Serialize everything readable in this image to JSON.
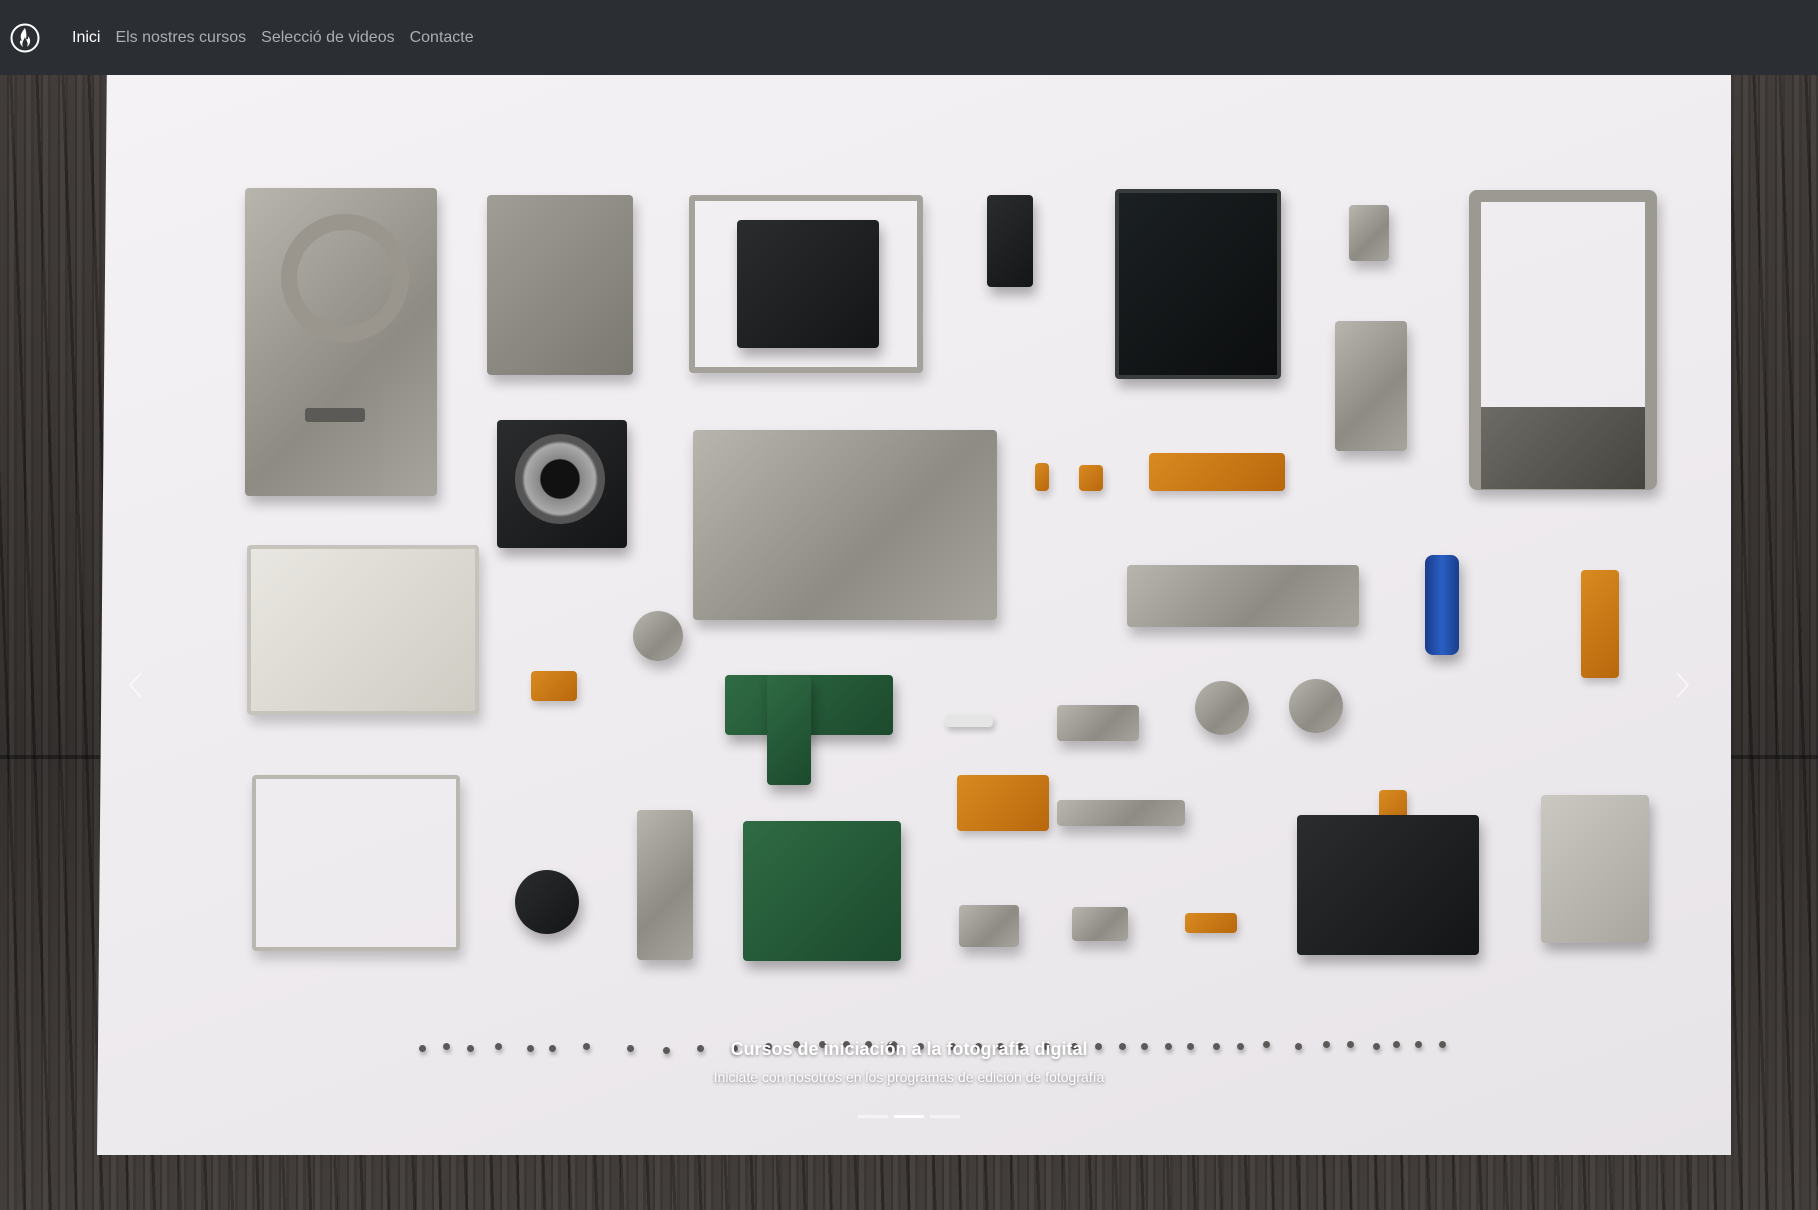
{
  "nav": {
    "brand_icon": "flame-logo-icon",
    "links": [
      {
        "label": "Inici",
        "active": true
      },
      {
        "label": "Els nostres cursos",
        "active": false
      },
      {
        "label": "Selecció de videos",
        "active": false
      },
      {
        "label": "Contacte",
        "active": false
      }
    ]
  },
  "carousel": {
    "slide_image": "disassembled-camera-parts",
    "caption_title": "Cursos de iniciación a la fotografía digital",
    "caption_subtitle": "Iniciate con nosotros en los programas de edición de fotografía",
    "indicator_count": 3,
    "active_indicator": 1,
    "prev_icon": "chevron-left-icon",
    "next_icon": "chevron-right-icon"
  },
  "colors": {
    "navbar_bg": "#2b2f33",
    "nav_active": "#ffffff",
    "nav_inactive": "#a9aeb3"
  }
}
